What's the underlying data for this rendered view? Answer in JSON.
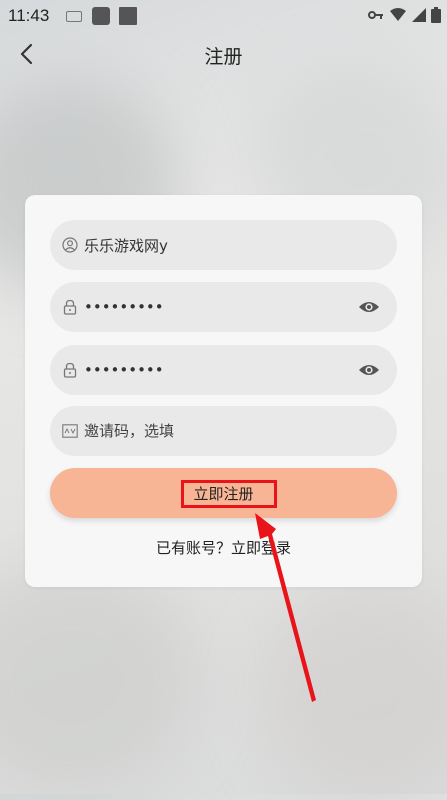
{
  "status": {
    "time": "11:43"
  },
  "header": {
    "title": "注册"
  },
  "form": {
    "username_value": "乐乐游戏网y",
    "password_value": "•••••••••",
    "confirm_password_value": "•••••••••",
    "invite_placeholder": "邀请码，选填",
    "register_label": "立即注册",
    "login_link": "已有账号？立即登录"
  },
  "colors": {
    "button": "#f8b596",
    "highlight": "#e8141a"
  }
}
